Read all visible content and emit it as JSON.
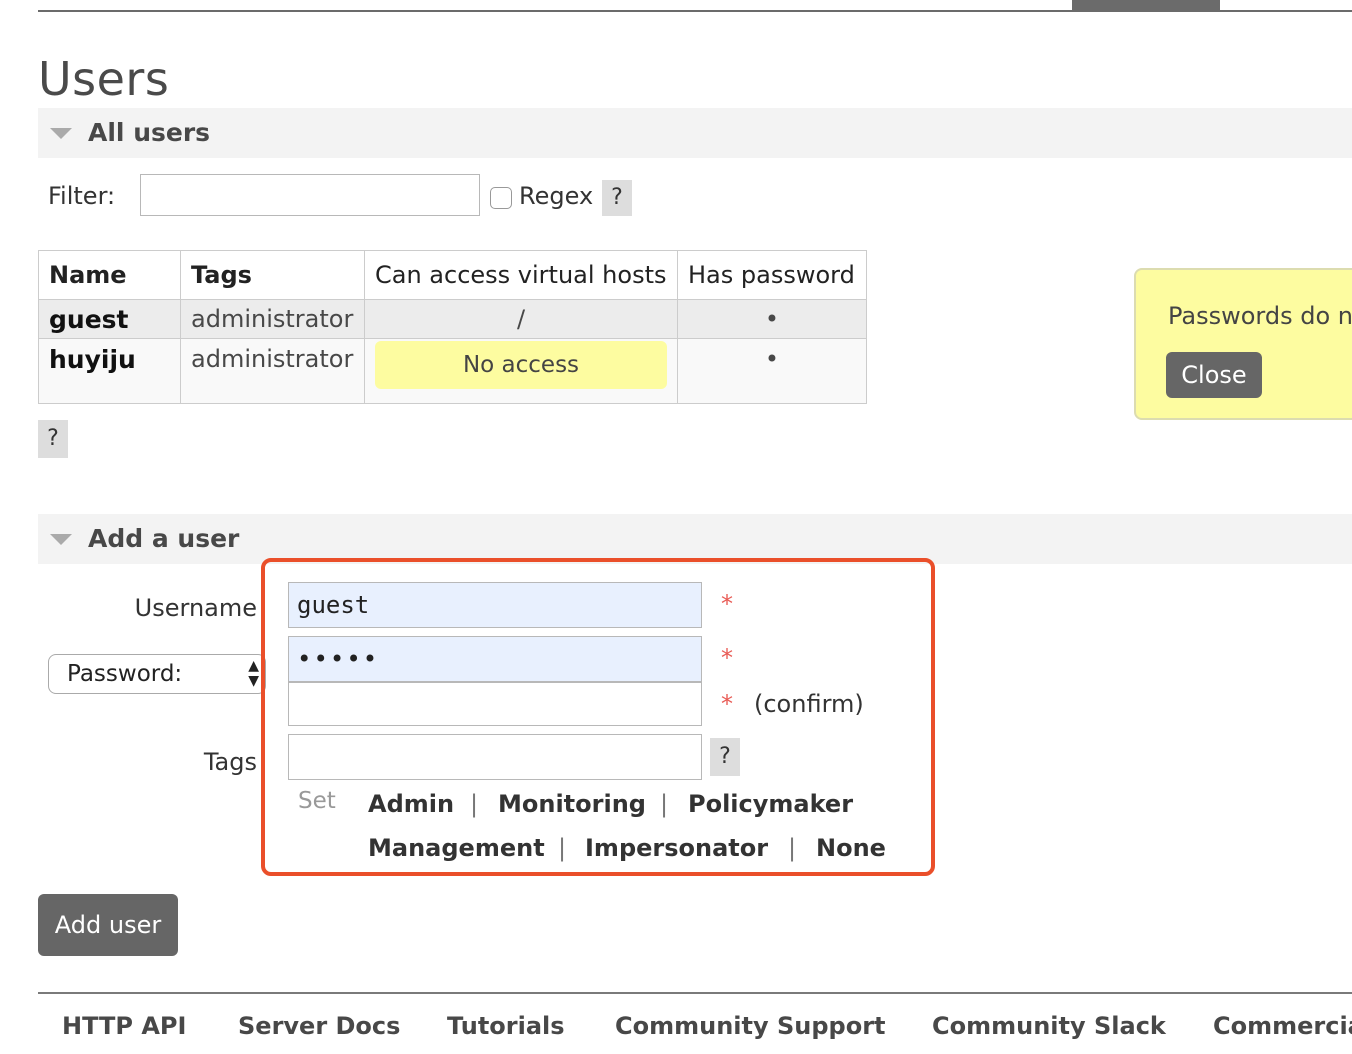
{
  "page": {
    "title": "Users"
  },
  "all_users": {
    "header": "All users",
    "filter_label": "Filter:",
    "filter_value": "",
    "regex_label": "Regex",
    "regex_checked": false,
    "help_label": "?",
    "table": {
      "columns": [
        "Name",
        "Tags",
        "Can access virtual hosts",
        "Has password"
      ],
      "rows": [
        {
          "name": "guest",
          "tags": "administrator",
          "vhosts": "/",
          "has_password": "•"
        },
        {
          "name": "huyiju",
          "tags": "administrator",
          "vhosts": "No access",
          "has_password": "•"
        }
      ]
    },
    "table_help_label": "?"
  },
  "notice": {
    "message": "Passwords do n",
    "close_label": "Close"
  },
  "add_user": {
    "header": "Add a user",
    "username_label": "Username",
    "username_value": "guest",
    "password_select": "Password:",
    "password_value": "•••••",
    "confirm_value": "",
    "required_mark": "*",
    "confirm_label": "(confirm)",
    "tags_label": "Tags",
    "tags_value": "",
    "tags_help_label": "?",
    "set_label": "Set",
    "tag_options": [
      "Admin",
      "Monitoring",
      "Policymaker",
      "Management",
      "Impersonator",
      "None"
    ],
    "separator": "|",
    "submit_label": "Add user"
  },
  "footer": {
    "links": [
      "HTTP API",
      "Server Docs",
      "Tutorials",
      "Community Support",
      "Community Slack",
      "Commercial"
    ]
  },
  "colors": {
    "highlight_outline": "#ea4f2a",
    "autofill_bg": "#e8f0fe",
    "notice_bg": "#fdfca0",
    "button_bg": "#666666",
    "required_star": "#e85b55"
  }
}
